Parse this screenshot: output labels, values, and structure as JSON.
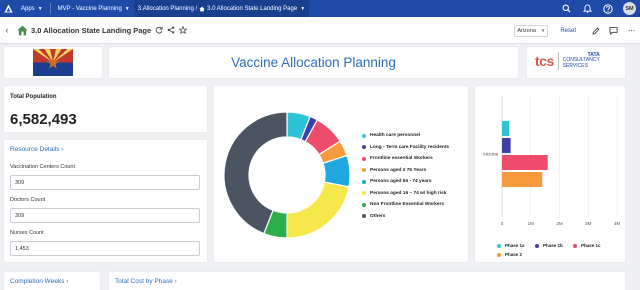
{
  "topbar": {
    "apps_label": "Apps",
    "project_label": "MVP - Vaccine Planning",
    "page_prefix": "3.Allocation Planning /",
    "page_current": "3.0 Allocation State Landing Page",
    "avatar_initials": "SM"
  },
  "subbar": {
    "title": "3.0 Allocation State Landing Page",
    "state_selected": "Arizona",
    "reset_label": "Reset"
  },
  "banner": {
    "title": "Vaccine Allocation Planning",
    "tcs_logo_top": "TATA",
    "tcs_logo_mid": "CONSULTANCY",
    "tcs_logo_bottom": "SERVICES",
    "tcs_letters": "tcs"
  },
  "population": {
    "label": "Total Population",
    "value": "6,582,493"
  },
  "resources": {
    "link_label": "Resource Details",
    "vaccination_centers_label": "Vaccination Centers Count",
    "vaccination_centers_value": "309",
    "doctors_label": "Doctors Count",
    "doctors_value": "309",
    "nurses_label": "Nurses Count",
    "nurses_value": "1,453"
  },
  "bottom": {
    "completion_weeks_label": "Completion Weeks",
    "total_cost_label": "Total Cost by Phase"
  },
  "colors": {
    "brand_blue": "#1f4aa8",
    "link_blue": "#2c6fbb"
  },
  "chart_data": [
    {
      "type": "pie",
      "variant": "donut",
      "categories": [
        "Health care personnel",
        "Long - Term care Facility residents",
        "Frontline essential Workers",
        "Persons aged ≥ 75 Years",
        "Persons aged 65 - 74 years",
        "Persons aged 16 – 74 w/ high risk",
        "Non Frontline Essential Workers",
        "Others"
      ],
      "values": [
        6,
        2,
        8,
        4,
        8,
        22,
        6,
        44
      ],
      "colors": [
        "#2ec4d6",
        "#3f3fa8",
        "#ef4b6b",
        "#f79a3e",
        "#1fa8e0",
        "#f6e84a",
        "#2dae4a",
        "#4b5562"
      ],
      "legend_position": "right"
    },
    {
      "type": "bar",
      "orientation": "horizontal",
      "categories": [
        "Arizona"
      ],
      "series": [
        {
          "name": "Phase 1a",
          "values": [
            250000
          ],
          "color": "#2ec4d6"
        },
        {
          "name": "Phase 1b",
          "values": [
            300000
          ],
          "color": "#3f3fa8"
        },
        {
          "name": "Phase 1c",
          "values": [
            1590000
          ],
          "color": "#ef4b6b"
        },
        {
          "name": "Phase 2",
          "values": [
            1400000
          ],
          "color": "#f79a3e"
        }
      ],
      "x_ticks": [
        "0",
        "1M",
        "2M",
        "3M",
        "4M"
      ],
      "xlim": [
        0,
        4000000
      ],
      "legend_position": "bottom"
    }
  ]
}
